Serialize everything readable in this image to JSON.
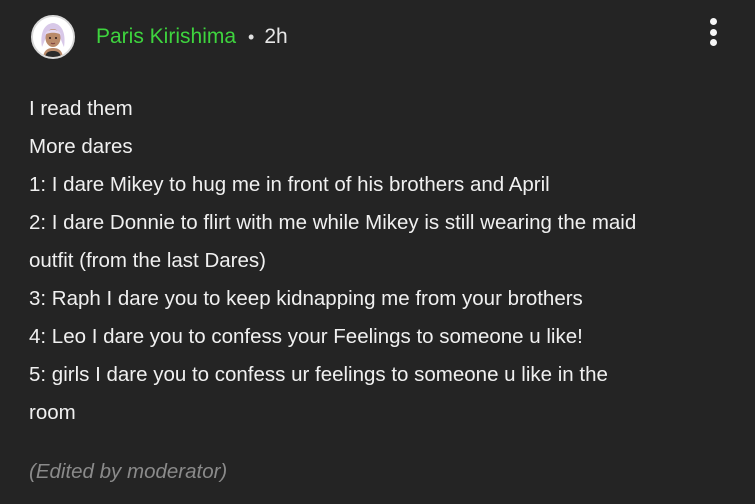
{
  "post": {
    "author": "Paris Kirishima",
    "separator": "•",
    "time": "2h",
    "avatar_icon": "character-avatar-icon",
    "menu_icon": "more-vertical-icon",
    "lines": [
      "I read them",
      "More dares",
      "1: I dare Mikey to hug me in front of his brothers and April",
      "2: I dare Donnie to flirt with me while Mikey is still wearing the maid",
      "outfit (from the last Dares)",
      "3: Raph I dare you to keep kidnapping me from your brothers",
      "4: Leo I dare you to confess your Feelings to someone u like!",
      "5: girls I dare you to confess ur feelings to someone u like in the",
      "room"
    ],
    "edited_note": "(Edited by moderator)"
  },
  "colors": {
    "background": "#242424",
    "author": "#3ed43e",
    "text": "#f0f0f0",
    "muted": "#8a8a8a"
  }
}
